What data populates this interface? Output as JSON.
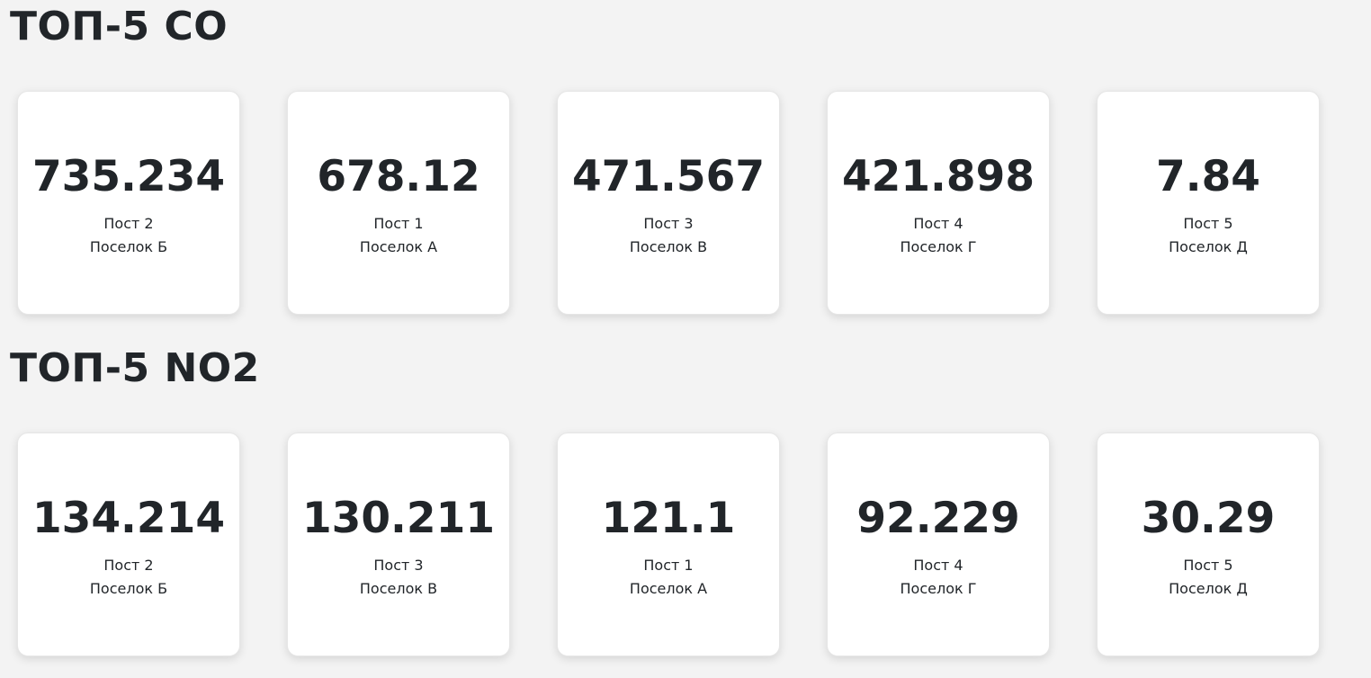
{
  "sections": [
    {
      "title": "ТОП-5 СО",
      "cards": [
        {
          "value": "735.234",
          "post": "Пост 2",
          "village": "Поселок Б"
        },
        {
          "value": "678.12",
          "post": "Пост 1",
          "village": "Поселок А"
        },
        {
          "value": "471.567",
          "post": "Пост 3",
          "village": "Поселок В"
        },
        {
          "value": "421.898",
          "post": "Пост 4",
          "village": "Поселок Г"
        },
        {
          "value": "7.84",
          "post": "Пост 5",
          "village": "Поселок Д"
        }
      ]
    },
    {
      "title": "ТОП-5 NO2",
      "cards": [
        {
          "value": "134.214",
          "post": "Пост 2",
          "village": "Поселок Б"
        },
        {
          "value": "130.211",
          "post": "Пост 3",
          "village": "Поселок В"
        },
        {
          "value": "121.1",
          "post": "Пост 1",
          "village": "Поселок А"
        },
        {
          "value": "92.229",
          "post": "Пост 4",
          "village": "Поселок Г"
        },
        {
          "value": "30.29",
          "post": "Пост 5",
          "village": "Поселок Д"
        }
      ]
    }
  ]
}
